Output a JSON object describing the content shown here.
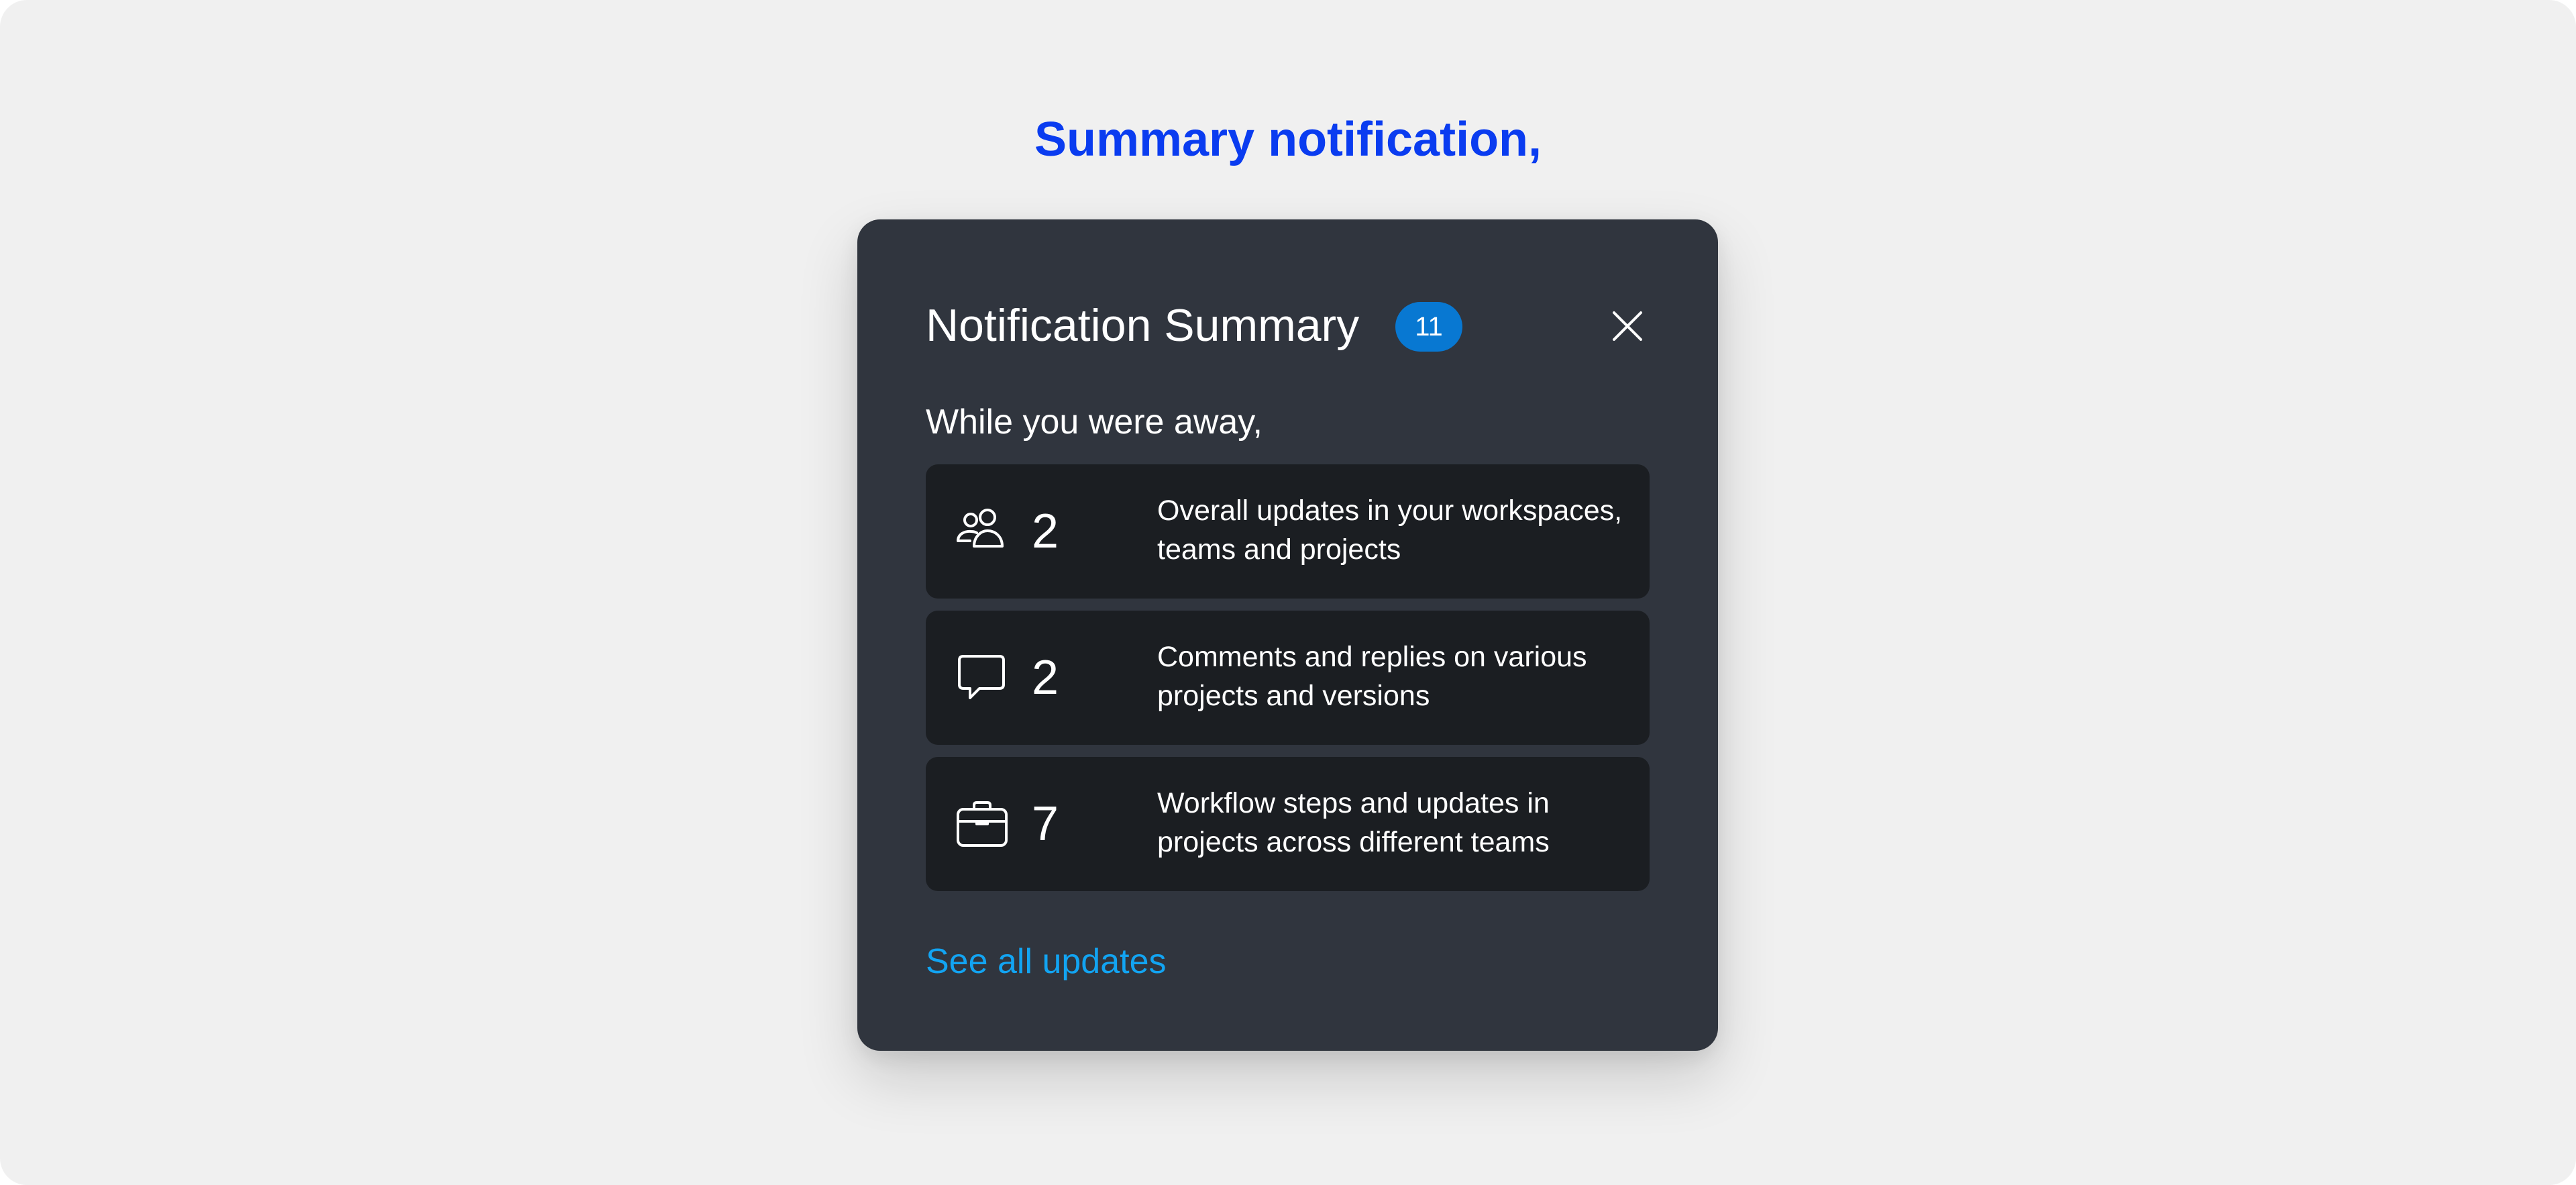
{
  "page": {
    "heading": "Summary notification,"
  },
  "card": {
    "title": "Notification Summary",
    "badge_count": "11",
    "close_icon": "close-icon",
    "intro": "While you were away,",
    "rows": [
      {
        "icon": "users-icon",
        "count": "2",
        "text": "Overall updates in your workspaces, teams and projects"
      },
      {
        "icon": "comment-icon",
        "count": "2",
        "text": "Comments and replies on various projects and versions"
      },
      {
        "icon": "briefcase-icon",
        "count": "7",
        "text": "Workflow steps and updates in projects across different teams"
      }
    ],
    "see_all_label": "See all updates"
  },
  "colors": {
    "heading": "#0a3cf0",
    "card_background": "#30353e",
    "row_background": "#1b1e22",
    "badge": "#0878d2",
    "link": "#12a4f2",
    "page_background": "#f0f0f0"
  }
}
